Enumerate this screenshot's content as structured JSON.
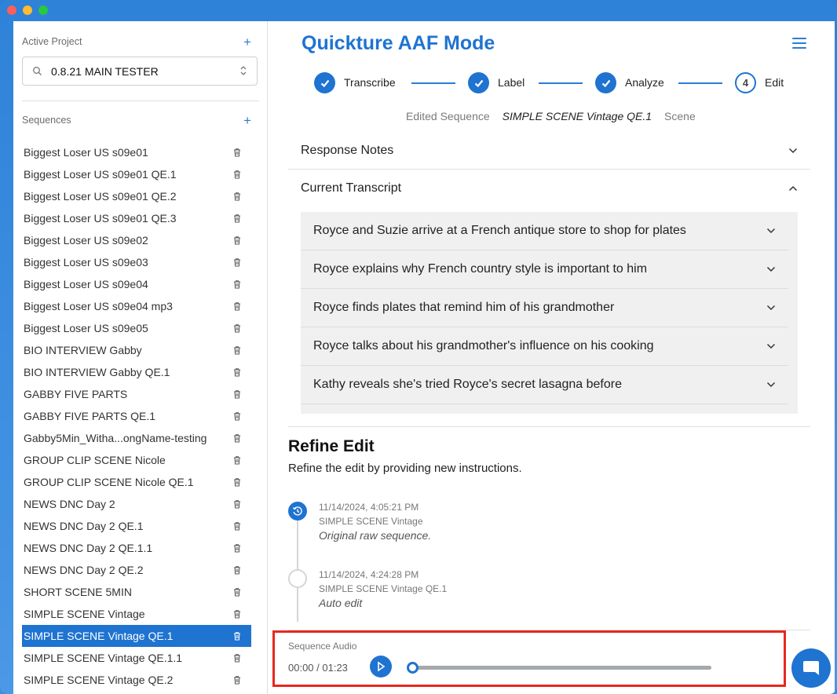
{
  "sidebar": {
    "active_project_label": "Active Project",
    "project_value": "0.8.21 MAIN TESTER",
    "sequences_label": "Sequences",
    "sequences": [
      "Biggest Loser US s09e01",
      "Biggest Loser US s09e01 QE.1",
      "Biggest Loser US s09e01 QE.2",
      "Biggest Loser US s09e01 QE.3",
      "Biggest Loser US s09e02",
      "Biggest Loser US s09e03",
      "Biggest Loser US s09e04",
      "Biggest Loser US s09e04 mp3",
      "Biggest Loser US s09e05",
      "BIO INTERVIEW Gabby",
      "BIO INTERVIEW Gabby QE.1",
      "GABBY FIVE PARTS",
      "GABBY FIVE PARTS QE.1",
      "Gabby5Min_Witha...ongName-testing",
      "GROUP CLIP SCENE Nicole",
      "GROUP CLIP SCENE Nicole QE.1",
      "NEWS DNC Day 2",
      "NEWS DNC Day 2 QE.1",
      "NEWS DNC Day 2 QE.1.1",
      "NEWS DNC Day 2 QE.2",
      "SHORT SCENE 5MIN",
      "SIMPLE SCENE Vintage",
      "SIMPLE SCENE Vintage QE.1",
      "SIMPLE SCENE Vintage QE.1.1",
      "SIMPLE SCENE Vintage QE.2"
    ],
    "active_sequence": "SIMPLE SCENE Vintage QE.1"
  },
  "header": {
    "title": "Quickture AAF Mode"
  },
  "stepper": {
    "steps": [
      {
        "label": "Transcribe",
        "status": "done"
      },
      {
        "label": "Label",
        "status": "done"
      },
      {
        "label": "Analyze",
        "status": "done"
      },
      {
        "label": "Edit",
        "status": "current",
        "number": "4"
      }
    ]
  },
  "edited_sequence": {
    "prefix": "Edited Sequence",
    "name": "SIMPLE SCENE Vintage QE.1",
    "suffix": "Scene"
  },
  "sections": {
    "response_notes": "Response Notes",
    "current_transcript": "Current Transcript"
  },
  "transcript_items": [
    "Royce and Suzie arrive at a French antique store to shop for plates",
    "Royce explains why French country style is important to him",
    "Royce finds plates that remind him of his grandmother",
    "Royce talks about his grandmother's influence on his cooking",
    "Kathy reveals she's tried Royce's secret lasagna before"
  ],
  "refine": {
    "title": "Refine Edit",
    "subtitle": "Refine the edit by providing new instructions."
  },
  "timeline": [
    {
      "timestamp": "11/14/2024, 4:05:21 PM",
      "sequence": "SIMPLE SCENE Vintage",
      "note": "Original raw sequence."
    },
    {
      "timestamp": "11/14/2024, 4:24:28 PM",
      "sequence": "SIMPLE SCENE Vintage QE.1",
      "note": "Auto edit"
    }
  ],
  "audio": {
    "label": "Sequence Audio",
    "time": "00:00 / 01:23",
    "progress": 0
  },
  "colors": {
    "accent": "#1f73d1",
    "highlight_box": "#e8271f"
  }
}
